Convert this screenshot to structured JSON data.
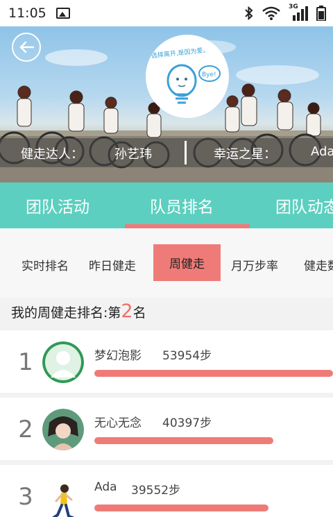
{
  "status_bar": {
    "time": "11:05",
    "icons": [
      "image-icon",
      "bluetooth-icon",
      "wifi-icon",
      "3g-signal-icon",
      "battery-icon"
    ],
    "network_label": "3G"
  },
  "banner": {
    "logo_text": "选择离开,是因为爱。",
    "logo_bubble": "Bye!",
    "ticker": {
      "label_1": "健走达人：",
      "value_1": "孙艺玮",
      "label_2": "幸运之星：",
      "value_2": "Ada"
    }
  },
  "main_tabs": [
    "团队活动",
    "队员排名",
    "团队动态"
  ],
  "main_tab_active_index": 1,
  "sub_tabs": [
    "实时排名",
    "昨日健走",
    "周健走",
    "月万步率",
    "健走数据"
  ],
  "sub_tab_active_index": 2,
  "my_rank": {
    "prefix": "我的周健走排名:第",
    "rank": "2",
    "suffix": "名"
  },
  "ranking": [
    {
      "rank": "1",
      "name": "梦幻泡影",
      "steps": "53954步",
      "bar_fraction": 1.0
    },
    {
      "rank": "2",
      "name": "无心无念",
      "steps": "40397步",
      "bar_fraction": 0.75
    },
    {
      "rank": "3",
      "name": "Ada",
      "steps": "39552步",
      "bar_fraction": 0.73
    }
  ],
  "colors": {
    "accent_teal": "#5ccfc0",
    "accent_coral": "#ef7b78",
    "page_bg": "#f2f2f2"
  }
}
